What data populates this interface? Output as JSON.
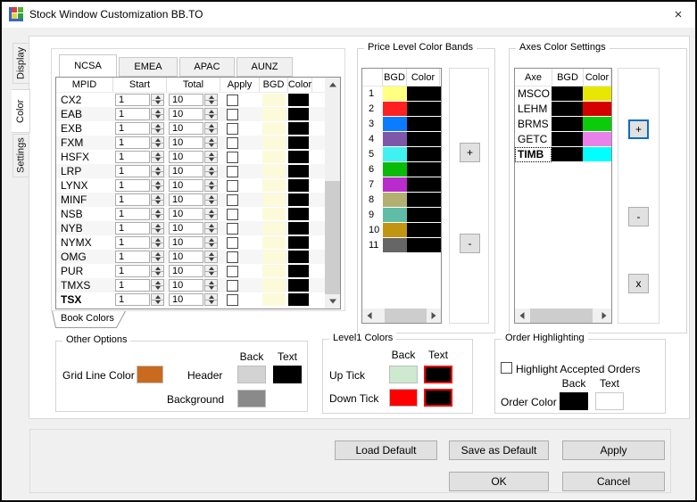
{
  "window": {
    "title": "Stock Window Customization BB.TO",
    "close": "×"
  },
  "side_tabs": {
    "display": "Display",
    "color": "Color",
    "settings": "Settings"
  },
  "region_tabs": {
    "ncsa": "NCSA",
    "emea": "EMEA",
    "apac": "APAC",
    "aunz": "AUNZ"
  },
  "book_tab_label": "Book Colors",
  "mpid_table": {
    "headers": {
      "mpid": "MPID",
      "start": "Start",
      "total": "Total",
      "apply": "Apply",
      "bgd": "BGD",
      "color": "Color"
    },
    "bgd_swatch": "#FCFAD9",
    "color_swatch": "#000000",
    "rows": [
      {
        "mpid": "CX2",
        "start": "1",
        "total": "10",
        "apply": false
      },
      {
        "mpid": "EAB",
        "start": "1",
        "total": "10",
        "apply": false
      },
      {
        "mpid": "EXB",
        "start": "1",
        "total": "10",
        "apply": false
      },
      {
        "mpid": "FXM",
        "start": "1",
        "total": "10",
        "apply": false
      },
      {
        "mpid": "HSFX",
        "start": "1",
        "total": "10",
        "apply": false
      },
      {
        "mpid": "LRP",
        "start": "1",
        "total": "10",
        "apply": false
      },
      {
        "mpid": "LYNX",
        "start": "1",
        "total": "10",
        "apply": false
      },
      {
        "mpid": "MINF",
        "start": "1",
        "total": "10",
        "apply": false
      },
      {
        "mpid": "NSB",
        "start": "1",
        "total": "10",
        "apply": false
      },
      {
        "mpid": "NYB",
        "start": "1",
        "total": "10",
        "apply": false
      },
      {
        "mpid": "NYMX",
        "start": "1",
        "total": "10",
        "apply": false
      },
      {
        "mpid": "OMG",
        "start": "1",
        "total": "10",
        "apply": false
      },
      {
        "mpid": "PUR",
        "start": "1",
        "total": "10",
        "apply": false
      },
      {
        "mpid": "TMXS",
        "start": "1",
        "total": "10",
        "apply": false
      },
      {
        "mpid": "TSX",
        "start": "1",
        "total": "10",
        "apply": false,
        "bold": true
      }
    ]
  },
  "price_bands": {
    "title": "Price Level Color Bands",
    "headers": {
      "bgd": "BGD",
      "color": "Color"
    },
    "color_swatch": "#000000",
    "add": "+",
    "remove": "-",
    "rows": [
      {
        "n": "1",
        "bgd": "#FFFF80"
      },
      {
        "n": "2",
        "bgd": "#FF2121"
      },
      {
        "n": "3",
        "bgd": "#0B7BFF"
      },
      {
        "n": "4",
        "bgd": "#7E57A8"
      },
      {
        "n": "5",
        "bgd": "#3FF2F2"
      },
      {
        "n": "6",
        "bgd": "#09BB09"
      },
      {
        "n": "7",
        "bgd": "#B92BCC"
      },
      {
        "n": "8",
        "bgd": "#B3AF70"
      },
      {
        "n": "9",
        "bgd": "#5FBCA7"
      },
      {
        "n": "10",
        "bgd": "#C29511"
      },
      {
        "n": "11",
        "bgd": "#666666"
      }
    ]
  },
  "axes_settings": {
    "title": "Axes Color Settings",
    "headers": {
      "axe": "Axe",
      "bgd": "BGD",
      "color": "Color"
    },
    "bgd_swatch": "#000000",
    "add": "+",
    "remove": "-",
    "delete": "x",
    "rows": [
      {
        "axe": "MSCO",
        "color": "#E6E600"
      },
      {
        "axe": "LEHM",
        "color": "#D40000"
      },
      {
        "axe": "BRMS",
        "color": "#0ACC0A"
      },
      {
        "axe": "GETC",
        "color": "#EA80EA"
      },
      {
        "axe": "TIMB",
        "color": "#00FFFF",
        "bold": true,
        "focused": true
      }
    ]
  },
  "other_options": {
    "title": "Other Options",
    "back": "Back",
    "text": "Text",
    "grid_line_label": "Grid Line Color",
    "grid_line_color": "#C96A1E",
    "header_label": "Header",
    "header_back": "#D3D3D3",
    "header_text": "#000000",
    "background_label": "Background",
    "background_color": "#8A8A8A"
  },
  "level1": {
    "title": "Level1 Colors",
    "back": "Back",
    "text": "Text",
    "up_label": "Up Tick",
    "up_back": "#CDE9CE",
    "up_text": "#000000",
    "down_label": "Down Tick",
    "down_back": "#FF0000",
    "down_text": "#000000",
    "text_border": "#FF0000"
  },
  "order": {
    "title": "Order Highlighting",
    "checkbox_label": "Highlight Accepted Orders",
    "checked": false,
    "back": "Back",
    "text": "Text",
    "label": "Order Color",
    "back_color": "#000000",
    "text_color": "#FFFFFF"
  },
  "footer": {
    "load_default": "Load Default",
    "save_as_default": "Save as Default",
    "apply": "Apply",
    "ok": "OK",
    "cancel": "Cancel"
  }
}
